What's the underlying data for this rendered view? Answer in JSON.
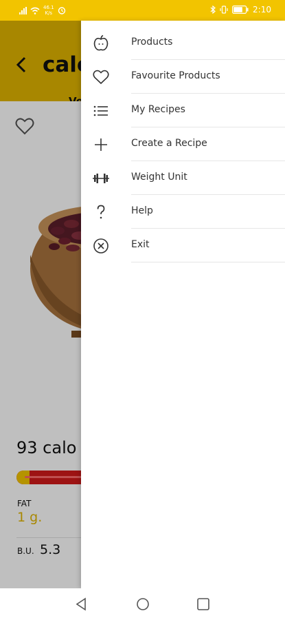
{
  "status_bar": {
    "network_top": "46.1",
    "network_bottom": "K/s",
    "battery_level": "75",
    "time": "2:10"
  },
  "product_page": {
    "title": "calc",
    "subtitle": "Ve",
    "calories": "93 calo",
    "fat_label": "FAT",
    "fat_value": "1 g.",
    "bu_label": "B.U.",
    "bu_value": "5.3",
    "colors": {
      "accent": "#f2c400",
      "bar": "#d21a1a"
    },
    "bar_fat_fraction": 0.08
  },
  "drawer": {
    "items": [
      {
        "label": "Products",
        "icon": "apple-icon"
      },
      {
        "label": "Favourite Products",
        "icon": "heart-icon"
      },
      {
        "label": "My Recipes",
        "icon": "list-icon"
      },
      {
        "label": "Create a Recipe",
        "icon": "plus-icon"
      },
      {
        "label": "Weight Unit",
        "icon": "dumbbell-icon"
      },
      {
        "label": "Help",
        "icon": "question-icon"
      },
      {
        "label": "Exit",
        "icon": "close-circle-icon"
      }
    ]
  },
  "nav": {
    "buttons": [
      "back-nav-icon",
      "home-nav-icon",
      "recents-nav-icon"
    ]
  }
}
